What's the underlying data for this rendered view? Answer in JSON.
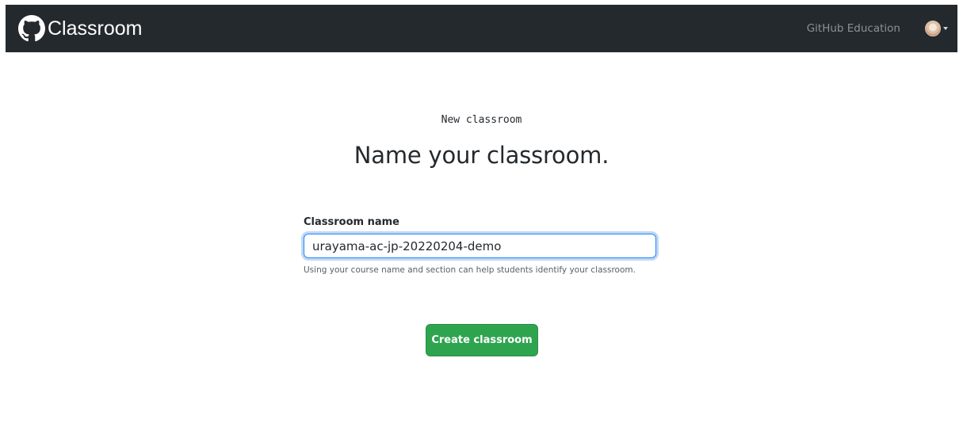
{
  "header": {
    "brand_icon": "github-octocat-icon",
    "brand_title": "Classroom",
    "nav_link": "GitHub Education",
    "avatar_icon": "user-avatar",
    "menu_icon": "chevron-down-icon"
  },
  "main": {
    "eyebrow": "New classroom",
    "title": "Name your classroom.",
    "field_label": "Classroom name",
    "field_value": "urayama-ac-jp-20220204-demo",
    "help_text": "Using your course name and section can help students identify your classroom.",
    "submit_label": "Create classroom"
  },
  "colors": {
    "header_bg": "#24292e",
    "primary_button": "#2ea44f",
    "input_focus": "#2188ff",
    "nav_link": "#8b9198"
  }
}
